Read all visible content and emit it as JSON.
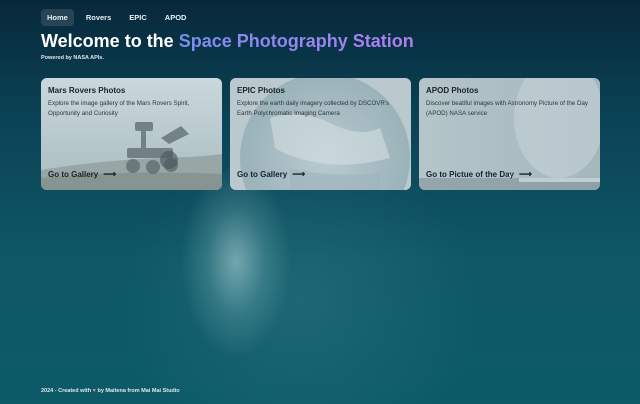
{
  "nav": {
    "items": [
      {
        "label": "Home",
        "active": true
      },
      {
        "label": "Rovers",
        "active": false
      },
      {
        "label": "EPIC",
        "active": false
      },
      {
        "label": "APOD",
        "active": false
      }
    ]
  },
  "hero": {
    "title_prefix": "Welcome to the",
    "title_accent": "Space Photography Station",
    "powered_by": "Powered by NASA APIs."
  },
  "cards": [
    {
      "title": "Mars Rovers Photos",
      "description": "Explore the image gallery of the Mars Rovers Spirit, Opportunity and Curiosity",
      "link": "Go to Gallery",
      "image": "mars-rover-image"
    },
    {
      "title": "EPIC Photos",
      "description": "Explore the earth daily imagery collected by DSCOVR's Earth Polychromatic Imaging Camera",
      "link": "Go to Gallery",
      "image": "earth-image"
    },
    {
      "title": "APOD Photos",
      "description": "Discover beatiful images with Astronomy Picture of the Day (APOD) NASA service",
      "link": "Go to Pictue of the Day",
      "image": "night-sky-image"
    }
  ],
  "footer": {
    "text_before": "2024 - Created with",
    "icon": "heart-icon",
    "text_after": "by Maitena from Mai Mai Studio"
  }
}
